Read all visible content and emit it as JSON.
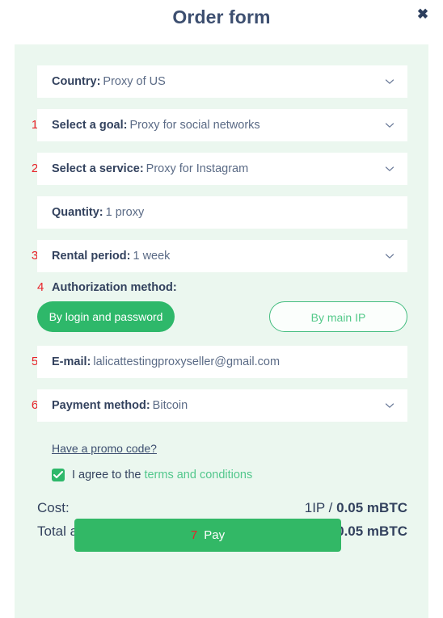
{
  "header": {
    "title": "Order form",
    "close_icon": "close-icon",
    "close_glyph": "✖"
  },
  "form": {
    "fields": [
      {
        "num": "",
        "label": "Country:",
        "value": "Proxy of US",
        "chevron": true
      },
      {
        "num": "1",
        "label": "Select a goal:",
        "value": "Proxy for social networks",
        "chevron": true
      },
      {
        "num": "2",
        "label": "Select a service:",
        "value": "Proxy for Instagram",
        "chevron": true
      },
      {
        "num": "",
        "label": "Quantity:",
        "value": "1 proxy",
        "chevron": false
      },
      {
        "num": "3",
        "label": "Rental period:",
        "value": "1 week",
        "chevron": true
      }
    ],
    "authorization": {
      "num": "4",
      "label": "Authorization method:",
      "selected_label": "By login and password",
      "alternate_label": "By main IP"
    },
    "email": {
      "num": "5",
      "label": "E-mail:",
      "value": "lalicattestingproxyseller@gmail.com"
    },
    "payment": {
      "num": "6",
      "label": "Payment method:",
      "value": "Bitcoin"
    },
    "promo_code_link": "Have a promo code?",
    "agreement": {
      "checked": true,
      "text": "I agree to the",
      "link_text": "terms and conditions"
    }
  },
  "summary": {
    "cost_label": "Cost:",
    "cost_value_light": "1IP / ",
    "cost_value_bold": "0.05 mBTC",
    "total_label": "Total amount:",
    "total_value": "0.05 mBTC"
  },
  "pay_button": {
    "num": "7",
    "label": "Pay"
  },
  "colors": {
    "panel_bg": "#ebf7ef",
    "accent_green": "#32b866",
    "annotation_red": "#e8232a",
    "text_navy": "#33425e",
    "link_green": "#52c78c"
  }
}
